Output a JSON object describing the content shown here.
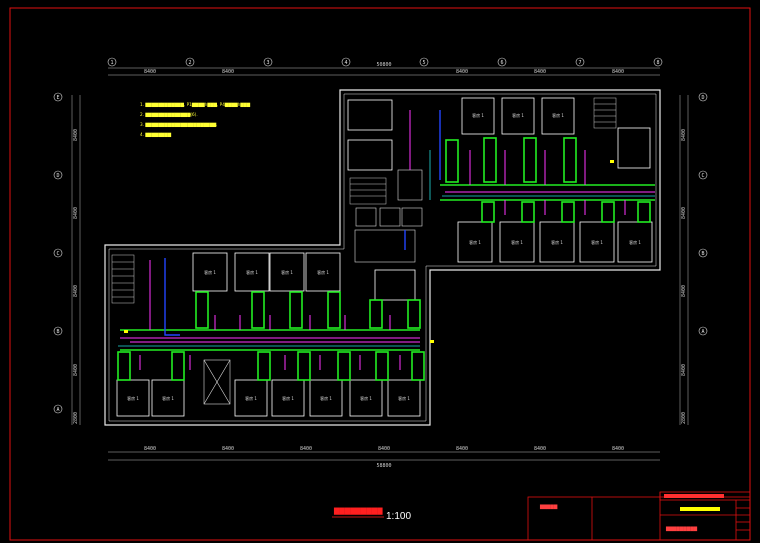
{
  "axes": {
    "top": [
      "1",
      "2",
      "3",
      "4",
      "5",
      "6",
      "7",
      "8"
    ],
    "left": [
      "E",
      "D",
      "C",
      "B",
      "A"
    ],
    "right": [
      "D",
      "C",
      "B",
      "A"
    ]
  },
  "dimensions": {
    "top_segments": [
      "8400",
      "8400",
      "",
      "",
      "8400",
      "8400",
      "8400"
    ],
    "top_total": "50800",
    "bottom_segments": [
      "8400",
      "8400",
      "8400",
      "8400",
      "8400",
      "8400",
      "8400"
    ],
    "bottom_total": "58800",
    "left": [
      "8400",
      "8400",
      "8400",
      "8400",
      "2800"
    ],
    "right": [
      "8400",
      "8400",
      "8400",
      "8400",
      "2800"
    ]
  },
  "room_label": "客房 1",
  "notes": [
    "1. ▇▇▇▇▇▇▇▇▇▇▇▇, P1▇▇▇▇h▇▇▇, P4▇▇▇▇h▇▇▇",
    "2. ▇▇▇▇▇▇▇▇▇▇▇▇▇▇(6).",
    "3. ▇▇▇▇▇▇▇▇▇▇▇▇▇▇▇▇▇▇▇▇▇▇.",
    "4. ▇▇▇▇▇▇▇▇"
  ],
  "drawing_title": "▇▇▇▇▇▇▇▇▇",
  "scale": "1:100",
  "title_block": {
    "designer": "▇▇▇▇▇",
    "drawing_name": "▇▇▇▇▇▇▇▇▇"
  },
  "colors": {
    "frame": "#e01010",
    "wall": "#e8e8e8",
    "room": "#ffffff",
    "duct_green": "#22ee22",
    "pipe_magenta": "#ff33ff",
    "pipe_blue": "#2244ff",
    "pipe_cyan": "#22dddd",
    "notes": "#ffff33",
    "accent_yellow": "#ffff00"
  }
}
